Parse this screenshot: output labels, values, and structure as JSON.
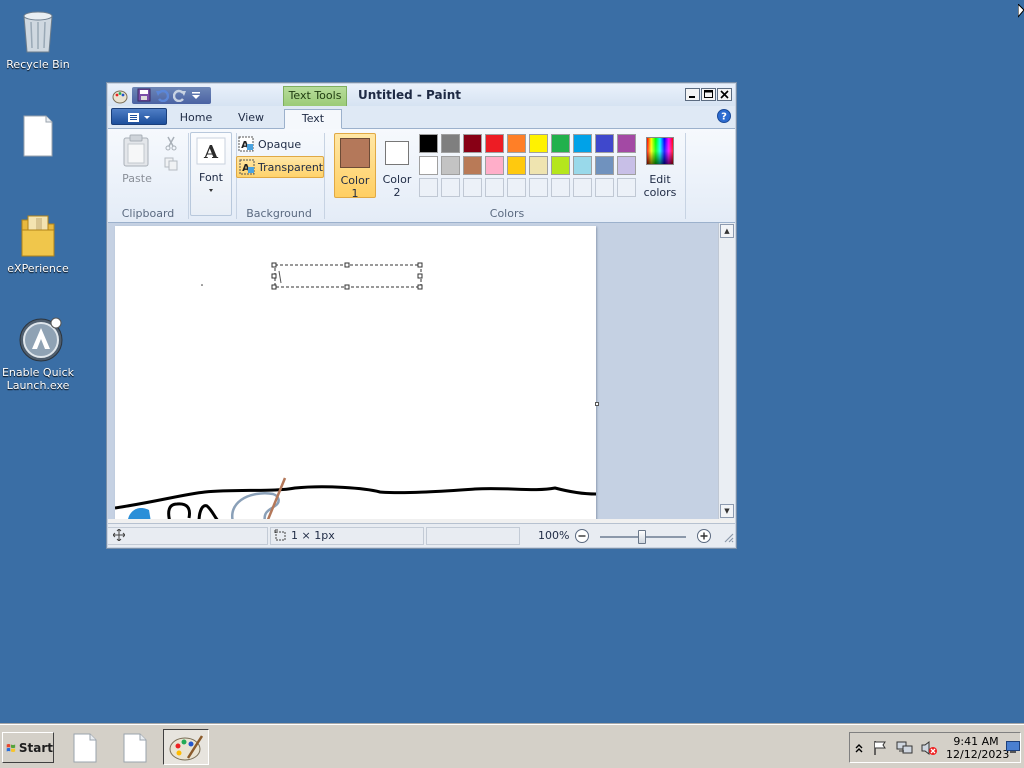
{
  "desktop": {
    "icons": [
      {
        "label": "Recycle Bin",
        "icon": "recycle-bin-icon"
      },
      {
        "label": "",
        "icon": "blank-file-icon"
      },
      {
        "label": "eXPerience",
        "icon": "folder-icon"
      },
      {
        "label": "Enable Quick Launch.exe",
        "icon": "quick-launch-app-icon"
      }
    ]
  },
  "window": {
    "title": "Untitled - Paint",
    "context_tab": "Text Tools",
    "tabs": [
      {
        "label": "Home",
        "active": false
      },
      {
        "label": "View",
        "active": false
      },
      {
        "label": "Text",
        "active": true
      }
    ],
    "ribbon": {
      "clipboard": {
        "label": "Clipboard",
        "paste": "Paste"
      },
      "font": {
        "label": "Font"
      },
      "background": {
        "label": "Background",
        "opaque": "Opaque",
        "transparent": "Transparent",
        "selected": "Transparent"
      },
      "colors": {
        "label": "Colors",
        "color1_label": "Color 1",
        "color2_label": "Color 2",
        "color1_value": "#b4785a",
        "color2_value": "#ffffff",
        "edit_colors": "Edit colors",
        "palette_row1": [
          "#000000",
          "#7f7f7f",
          "#880015",
          "#ed1c24",
          "#ff7f27",
          "#fff200",
          "#22b14c",
          "#00a2e8",
          "#3f48cc",
          "#a349a4"
        ],
        "palette_row2": [
          "#ffffff",
          "#c3c3c3",
          "#b97a57",
          "#ffaec9",
          "#ffc90e",
          "#efe4b0",
          "#b5e61d",
          "#99d9ea",
          "#7092be",
          "#c8bfe7"
        ]
      }
    },
    "status": {
      "selection_size": "1 × 1px",
      "zoom": "100%"
    }
  },
  "taskbar": {
    "start_label": "Start",
    "clock_time": "9:41 AM",
    "clock_date": "12/12/2023"
  }
}
